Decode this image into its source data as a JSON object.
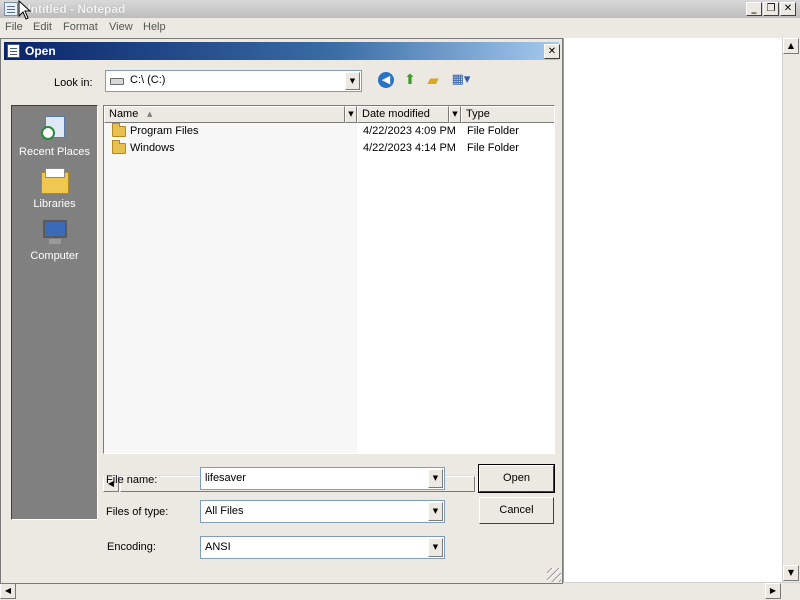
{
  "window": {
    "title": "Untitled - Notepad",
    "menu": [
      "File",
      "Edit",
      "Format",
      "View",
      "Help"
    ]
  },
  "dialog": {
    "title": "Open",
    "look_in_label": "Look in:",
    "look_in_value": "C:\\  (C:)",
    "places": [
      "Recent Places",
      "Libraries",
      "Computer"
    ],
    "columns": [
      "Name",
      "Date modified",
      "Type"
    ],
    "files": [
      {
        "name": "Program Files",
        "date": "4/22/2023 4:09 PM",
        "type": "File Folder"
      },
      {
        "name": "Windows",
        "date": "4/22/2023 4:14 PM",
        "type": "File Folder"
      }
    ],
    "file_name_label": "File name:",
    "file_name_value": "lifesaver",
    "files_of_type_label": "Files of type:",
    "files_of_type_value": "All Files",
    "encoding_label": "Encoding:",
    "encoding_value": "ANSI",
    "open_button": "Open",
    "cancel_button": "Cancel"
  },
  "icons": {
    "back": "back-arrow-icon",
    "up": "up-folder-icon",
    "new_folder": "new-folder-icon",
    "views": "views-menu-icon"
  },
  "colors": {
    "dialog_title_start": "#0a246a",
    "dialog_title_end": "#a6caf0",
    "places_bg": "#808080",
    "face": "#ece9e2"
  }
}
